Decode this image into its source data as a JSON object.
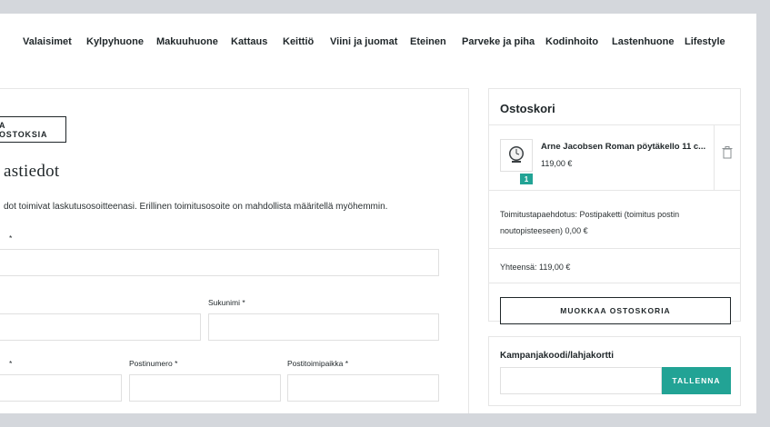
{
  "nav": {
    "items": [
      "Valaisimet",
      "Kylpyhuone",
      "Makuuhuone",
      "Kattaus",
      "Keittiö",
      "Viini ja juomat",
      "Eteinen",
      "Parveke ja piha",
      "Kodinhoito",
      "Lastenhuone",
      "Lifestyle"
    ]
  },
  "checkout": {
    "back_button_label": "A OSTOKSIA",
    "section_title": "astiedot",
    "info_text": "dot toimivat laskutusosoitteenasi. Erillinen toimitusosoite on mahdollista määritellä myöhemmin.",
    "field1_label": "*",
    "lastname_label": "Sukunimi *",
    "address_label": "*",
    "postcode_label": "Postinumero *",
    "city_label": "Postitoimipaikka *"
  },
  "cart": {
    "title": "Ostoskori",
    "item": {
      "name": "Arne Jacobsen Roman pöytäkello 11 c...",
      "price": "119,00 €",
      "quantity": "1"
    },
    "shipping_text": "Toimitustapaehdotus: Postipaketti (toimitus postin noutopisteeseen) 0,00 €",
    "total_text": "Yhteensä: 119,00 €",
    "edit_button": "MUOKKAA OSTOSKORIA"
  },
  "promo": {
    "label": "Kampanjakoodi/lahjakortti",
    "input_placeholder": "",
    "button": "TALLENNA"
  },
  "colors": {
    "accent": "#22a395",
    "text": "#1f2629",
    "border": "#e0e0e0",
    "background": "#d4d7dc"
  }
}
